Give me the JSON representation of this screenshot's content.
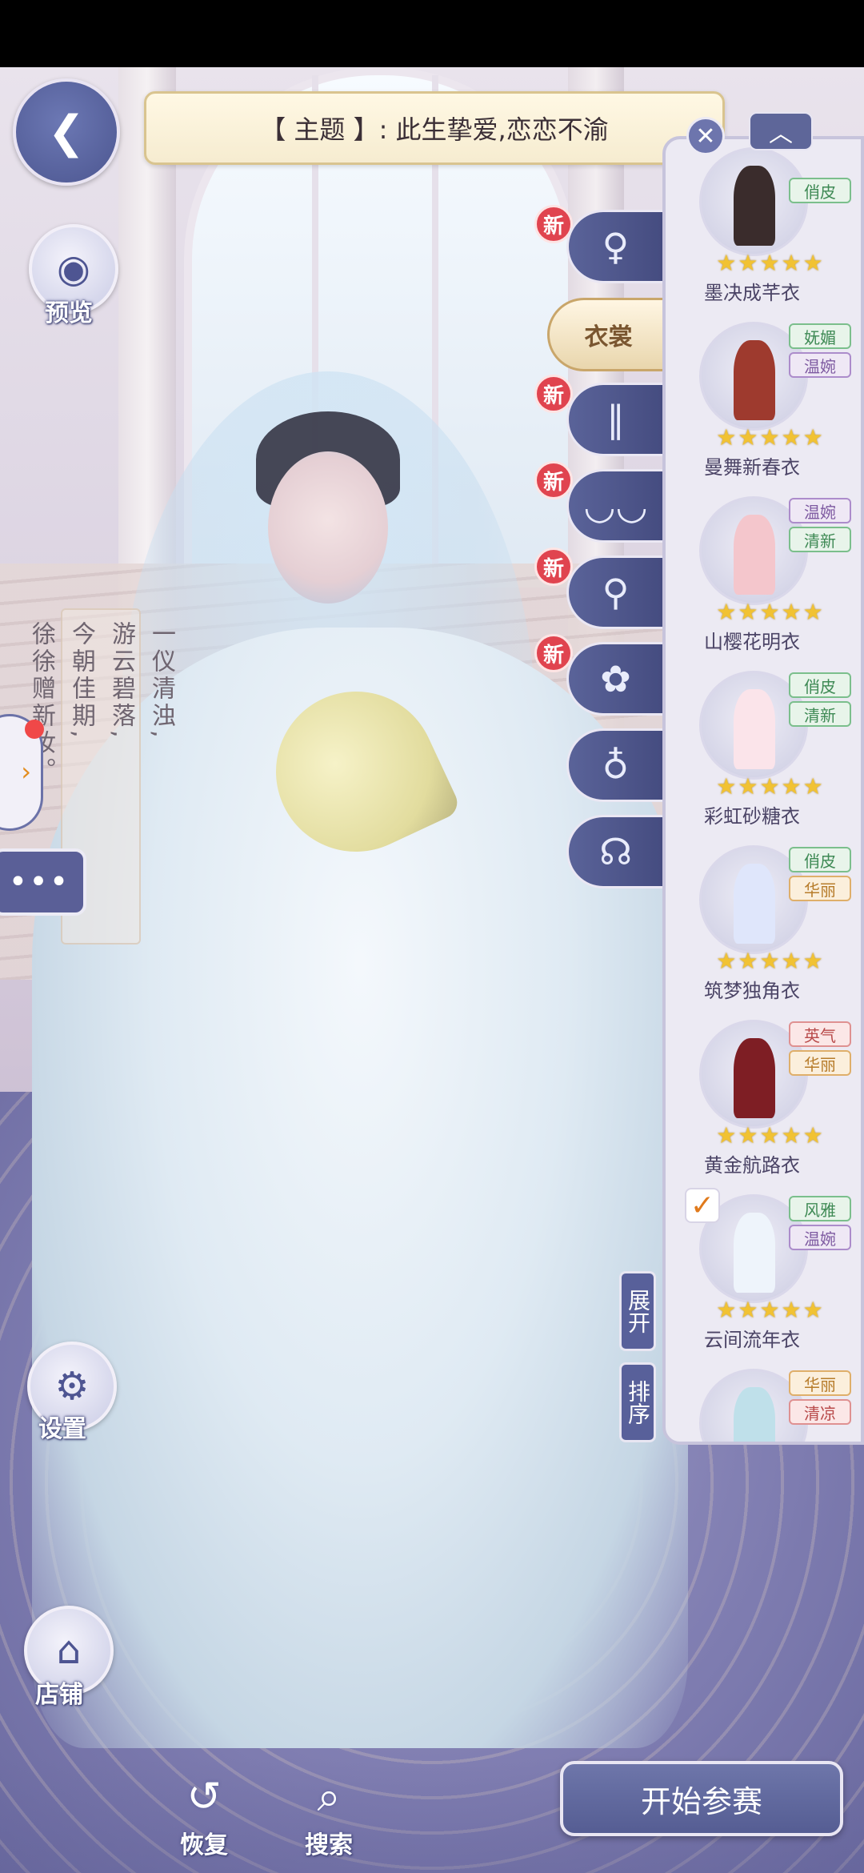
{
  "theme": {
    "text": "【 主题 】:  此生挚爱,恋恋不渝"
  },
  "left_buttons": {
    "preview": "预览",
    "settings": "设置",
    "shop": "店铺"
  },
  "poem": {
    "col1": "一仪清浊,",
    "col2": "游云碧落,",
    "col3": "今朝佳期,",
    "col4": "徐徐赠新妆。"
  },
  "chat_icon": "•••",
  "categories": {
    "selected_label": "衣裳",
    "new_badge": "新"
  },
  "panel": {
    "close": "✕",
    "collapse": "︿",
    "items": [
      {
        "name": "墨决成芊衣",
        "tags": [
          "俏皮"
        ],
        "stars": "★★★★★"
      },
      {
        "name": "曼舞新春衣",
        "tags": [
          "妩媚",
          "温婉"
        ],
        "stars": "★★★★★"
      },
      {
        "name": "山樱花明衣",
        "tags": [
          "温婉",
          "清新"
        ],
        "stars": "★★★★★"
      },
      {
        "name": "彩虹砂糖衣",
        "tags": [
          "俏皮",
          "清新"
        ],
        "stars": "★★★★★"
      },
      {
        "name": "筑梦独角衣",
        "tags": [
          "俏皮",
          "华丽"
        ],
        "stars": "★★★★★"
      },
      {
        "name": "黄金航路衣",
        "tags": [
          "英气",
          "华丽"
        ],
        "stars": "★★★★★"
      },
      {
        "name": "云间流年衣",
        "tags": [
          "风雅",
          "温婉"
        ],
        "stars": "★★★★★",
        "selected": true
      },
      {
        "name": "",
        "tags": [
          "华丽",
          "清凉"
        ],
        "stars": ""
      }
    ]
  },
  "side_buttons": {
    "expand": "展开",
    "sort": "排序"
  },
  "bottom": {
    "restore": "恢复",
    "search": "搜索",
    "start": "开始参赛"
  },
  "colors": {
    "accent": "#5a6399",
    "star": "#f1c233",
    "new_badge": "#e0444f"
  }
}
